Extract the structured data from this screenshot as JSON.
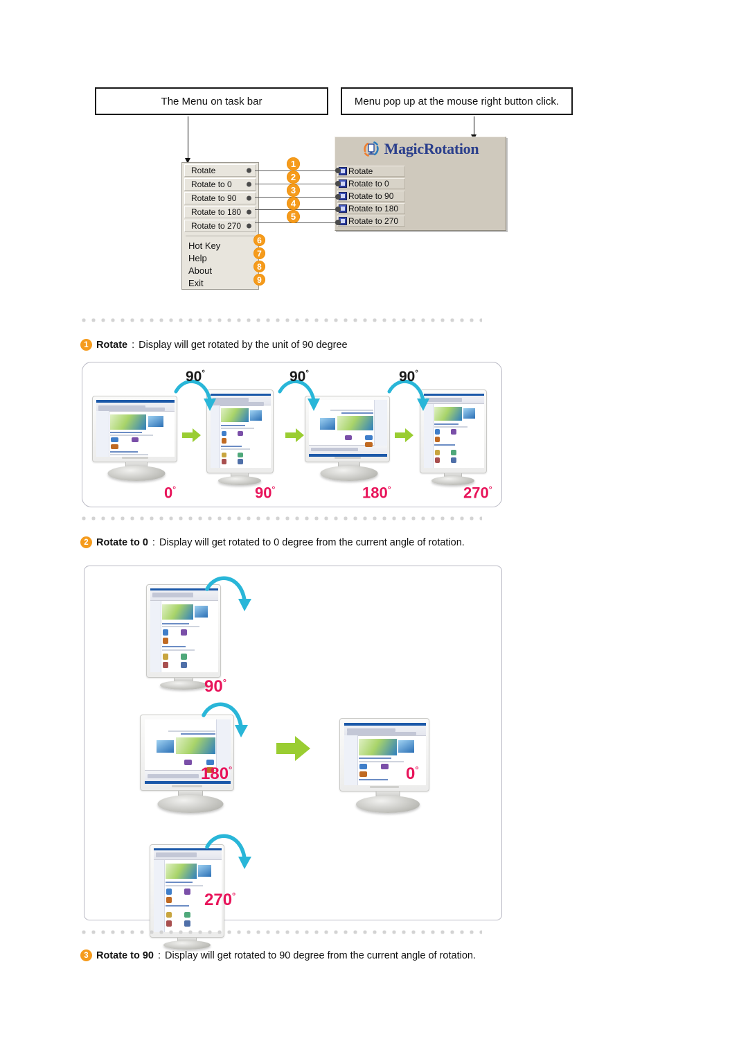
{
  "callouts": {
    "task_bar": "The Menu on task bar",
    "popup": "Menu pop up at the mouse right button click."
  },
  "task_menu": {
    "items": [
      {
        "label": "Rotate"
      },
      {
        "label": "Rotate to 0"
      },
      {
        "label": "Rotate to 90"
      },
      {
        "label": "Rotate to 180"
      },
      {
        "label": "Rotate to 270"
      }
    ],
    "plain_items": [
      {
        "label": "Hot Key"
      },
      {
        "label": "Help"
      },
      {
        "label": "About"
      },
      {
        "label": "Exit"
      }
    ]
  },
  "popup_menu": {
    "title": "MagicRotation",
    "items": [
      {
        "label": "Rotate",
        "icon": "rotate-icon"
      },
      {
        "label": "Rotate to 0",
        "icon": "rotate-0-icon"
      },
      {
        "label": "Rotate to 90",
        "icon": "rotate-90-icon"
      },
      {
        "label": "Rotate to 180",
        "icon": "rotate-180-icon"
      },
      {
        "label": "Rotate to 270",
        "icon": "rotate-270-icon"
      }
    ]
  },
  "badges": [
    "1",
    "2",
    "3",
    "4",
    "5",
    "6",
    "7",
    "8",
    "9"
  ],
  "sections": [
    {
      "num": "1",
      "term": "Rotate",
      "sep": " : ",
      "text": "Display will get rotated by the unit of 90 degree"
    },
    {
      "num": "2",
      "term": "Rotate to 0",
      "sep": " : ",
      "text": "Display will get rotated to 0 degree from the current angle of rotation."
    },
    {
      "num": "3",
      "term": "Rotate to 90",
      "sep": " : ",
      "text": "Display will get rotated to 90 degree from the current angle of rotation."
    }
  ],
  "figure1": {
    "step_labels": [
      "90",
      "90",
      "90"
    ],
    "angle_labels": [
      "0",
      "90",
      "180",
      "270"
    ],
    "degree_symbol": "°"
  },
  "figure2": {
    "angle_labels": [
      "90",
      "180",
      "270",
      "0"
    ],
    "degree_symbol": "°"
  },
  "colors": {
    "badge_orange": "#f59b1c",
    "angle_pink": "#e8145a",
    "arrow_green": "#9acd32",
    "arrow_cyan": "#29b6d8",
    "logo_blue": "#2b3f8c"
  }
}
